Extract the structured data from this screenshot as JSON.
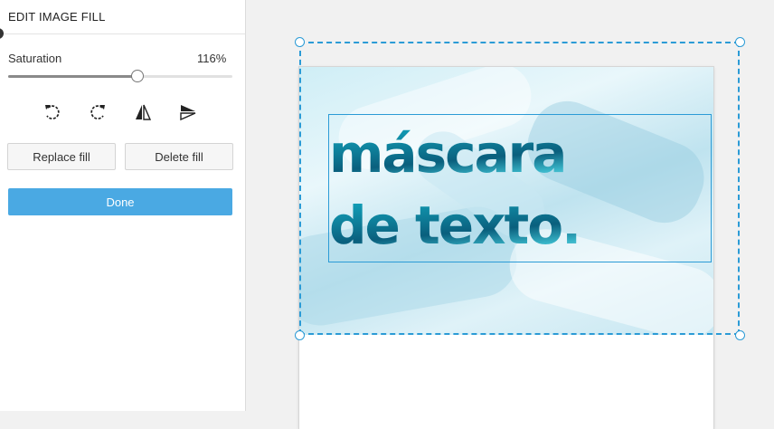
{
  "panel": {
    "title": "EDIT IMAGE FILL",
    "saturation": {
      "label": "Saturation",
      "value_text": "116%",
      "slider_fraction": 0.575
    },
    "tools": [
      {
        "name": "rotate-left-icon"
      },
      {
        "name": "rotate-right-icon"
      },
      {
        "name": "flip-horizontal-icon"
      },
      {
        "name": "flip-vertical-icon"
      }
    ],
    "replace_fill_label": "Replace fill",
    "delete_fill_label": "Delete fill",
    "done_label": "Done"
  },
  "canvas": {
    "text_lines": [
      "máscara",
      "de texto."
    ],
    "colors": {
      "selection": "#2b9bd6",
      "accent_button": "#4aa9e3",
      "text_fill_dark": "#0a5f7d",
      "text_fill_light": "#39b6c9"
    }
  }
}
